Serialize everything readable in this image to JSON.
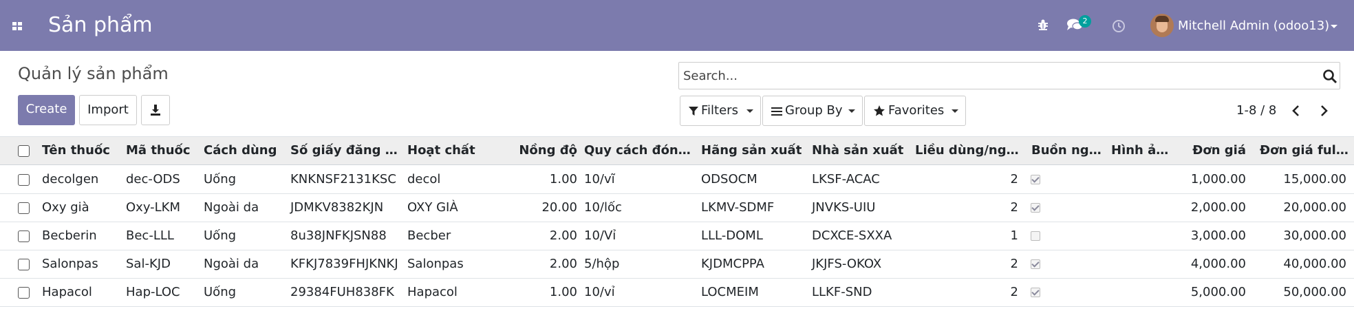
{
  "navbar": {
    "app_title": "Sản phẩm",
    "chat_count": "2",
    "user_name": "Mitchell Admin (odoo13)",
    "icons": [
      "apps-icon",
      "bug-icon",
      "chat-icon",
      "clock-icon",
      "avatar"
    ],
    "color": "#7c7bad"
  },
  "control": {
    "breadcrumb": "Quản lý sản phẩm",
    "create_label": "Create",
    "import_label": "Import",
    "search_placeholder": "Search...",
    "filters_label": "Filters",
    "groupby_label": "Group By",
    "favorites_label": "Favorites",
    "pager": "1-8 / 8"
  },
  "table": {
    "headers": [
      "Tên thuốc",
      "Mã thuốc",
      "Cách dùng",
      "Số giấy đăng k...",
      "Hoạt chất",
      "Nồng độ",
      "Quy cách đóng ...",
      "Hãng sản xuất",
      "Nhà sản xuất",
      "Liều dùng/ngà...",
      "Buồn ngủ...",
      "Hình ảnh",
      "Đơn giá",
      "Đơn giá full..."
    ],
    "rows": [
      {
        "name": "decolgen",
        "code": "dec-ODS",
        "usage": "Uống",
        "reg": "KNKNSF2131KSC",
        "ingredient": "decol",
        "conc": "1.00",
        "pack": "10/vĩ",
        "brand": "ODSOCM",
        "maker": "LKSF-ACAC",
        "dose": "2",
        "drowsy": true,
        "image": "",
        "price": "1,000.00",
        "price_full": "15,000.00"
      },
      {
        "name": "Oxy già",
        "code": "Oxy-LKM",
        "usage": "Ngoài da",
        "reg": "JDMKV8382KJN",
        "ingredient": "OXY GIÀ",
        "conc": "20.00",
        "pack": "10/lốc",
        "brand": "LKMV-SDMF",
        "maker": "JNVKS-UIU",
        "dose": "2",
        "drowsy": true,
        "image": "",
        "price": "2,000.00",
        "price_full": "20,000.00"
      },
      {
        "name": "Becberin",
        "code": "Bec-LLL",
        "usage": "Uống",
        "reg": "8u38JNFKJSN88",
        "ingredient": "Becber",
        "conc": "2.00",
        "pack": "10/Vỉ",
        "brand": "LLL-DOML",
        "maker": "DCXCE-SXXA",
        "dose": "1",
        "drowsy": false,
        "image": "",
        "price": "3,000.00",
        "price_full": "30,000.00"
      },
      {
        "name": "Salonpas",
        "code": "Sal-KJD",
        "usage": "Ngoài da",
        "reg": "KFKJ7839FHJKNKJ",
        "ingredient": "Salonpas",
        "conc": "2.00",
        "pack": "5/hộp",
        "brand": "KJDMCPPA",
        "maker": "JKJFS-OKOX",
        "dose": "2",
        "drowsy": true,
        "image": "",
        "price": "4,000.00",
        "price_full": "40,000.00"
      },
      {
        "name": "Hapacol",
        "code": "Hap-LOC",
        "usage": "Uống",
        "reg": "29384FUH838FK",
        "ingredient": "Hapacol",
        "conc": "1.00",
        "pack": "10/vỉ",
        "brand": "LOCMEIM",
        "maker": "LLKF-SND",
        "dose": "2",
        "drowsy": true,
        "image": "",
        "price": "5,000.00",
        "price_full": "50,000.00"
      }
    ]
  }
}
